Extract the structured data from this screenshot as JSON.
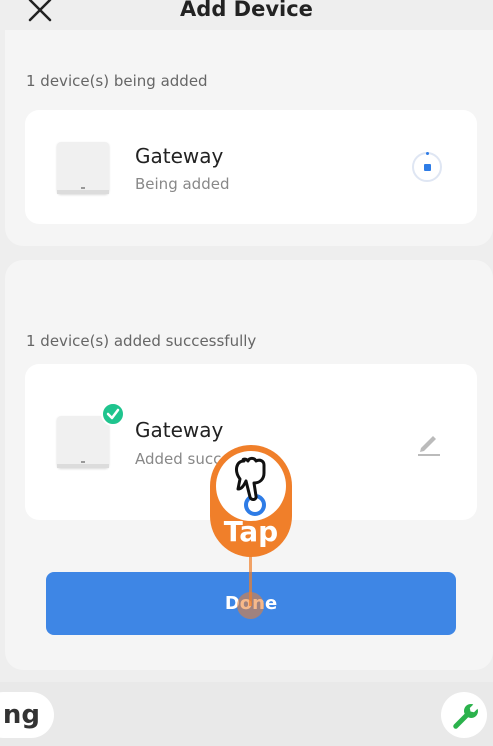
{
  "header": {
    "title": "Add Device"
  },
  "adding_section": {
    "label": "1 device(s) being added",
    "device": {
      "name": "Gateway",
      "status": "Being added"
    }
  },
  "added_section": {
    "label": "1 device(s) added successfully",
    "device": {
      "name": "Gateway",
      "status": "Added successfully"
    }
  },
  "done_label": "Done",
  "tap_overlay": {
    "label": "Tap"
  },
  "bottom": {
    "partial_label": "ng"
  },
  "colors": {
    "accent": "#3e86e5",
    "success": "#1fc48e",
    "tap": "#f07f2a",
    "wrench": "#2bb24c"
  },
  "icons": [
    "close-icon",
    "loading-spinner-icon",
    "check-icon",
    "edit-pencil-icon",
    "pointing-hand-icon",
    "wrench-icon"
  ]
}
